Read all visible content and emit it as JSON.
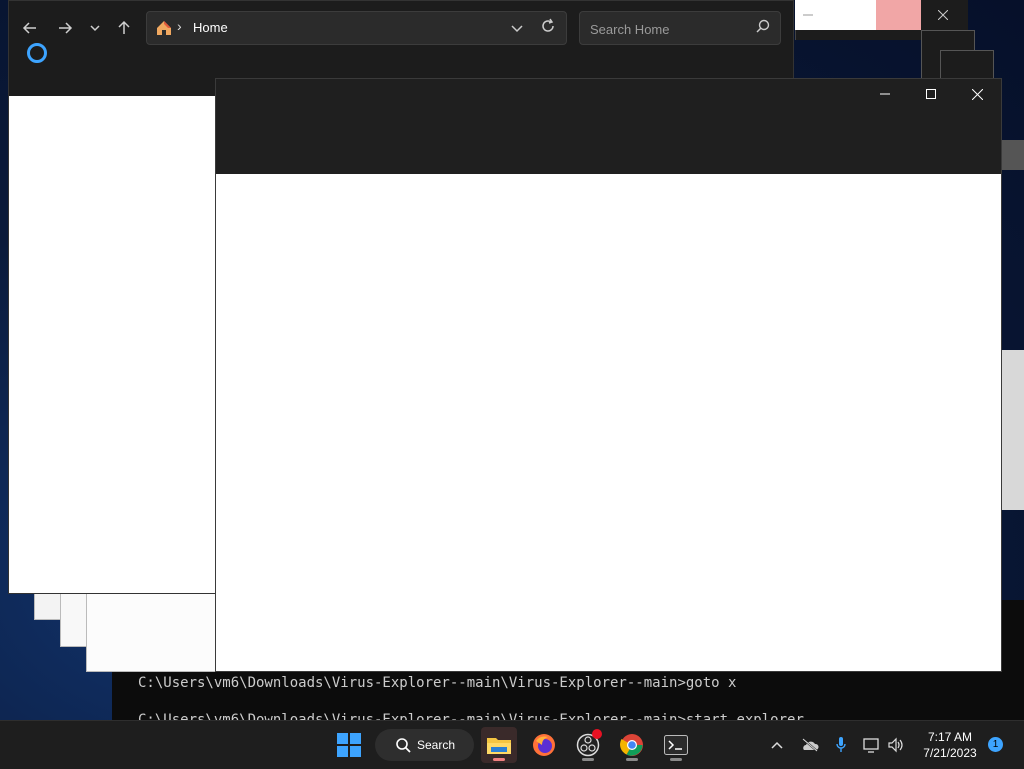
{
  "explorer": {
    "address_label": "Home",
    "search_placeholder": "Search Home"
  },
  "console": {
    "line1": "C:\\Users\\vm6\\Downloads\\Virus-Explorer--main\\Virus-Explorer--main>goto x",
    "line2": "C:\\Users\\vm6\\Downloads\\Virus-Explorer--main\\Virus-Explorer--main>start explorer"
  },
  "taskbar": {
    "search_label": "Search",
    "time": "7:17 AM",
    "date": "7/21/2023",
    "notification_count": "1"
  },
  "colors": {
    "accent": "#3da4ff",
    "window_dark": "#1c1c1c",
    "close_hover": "#f1a6a6"
  }
}
